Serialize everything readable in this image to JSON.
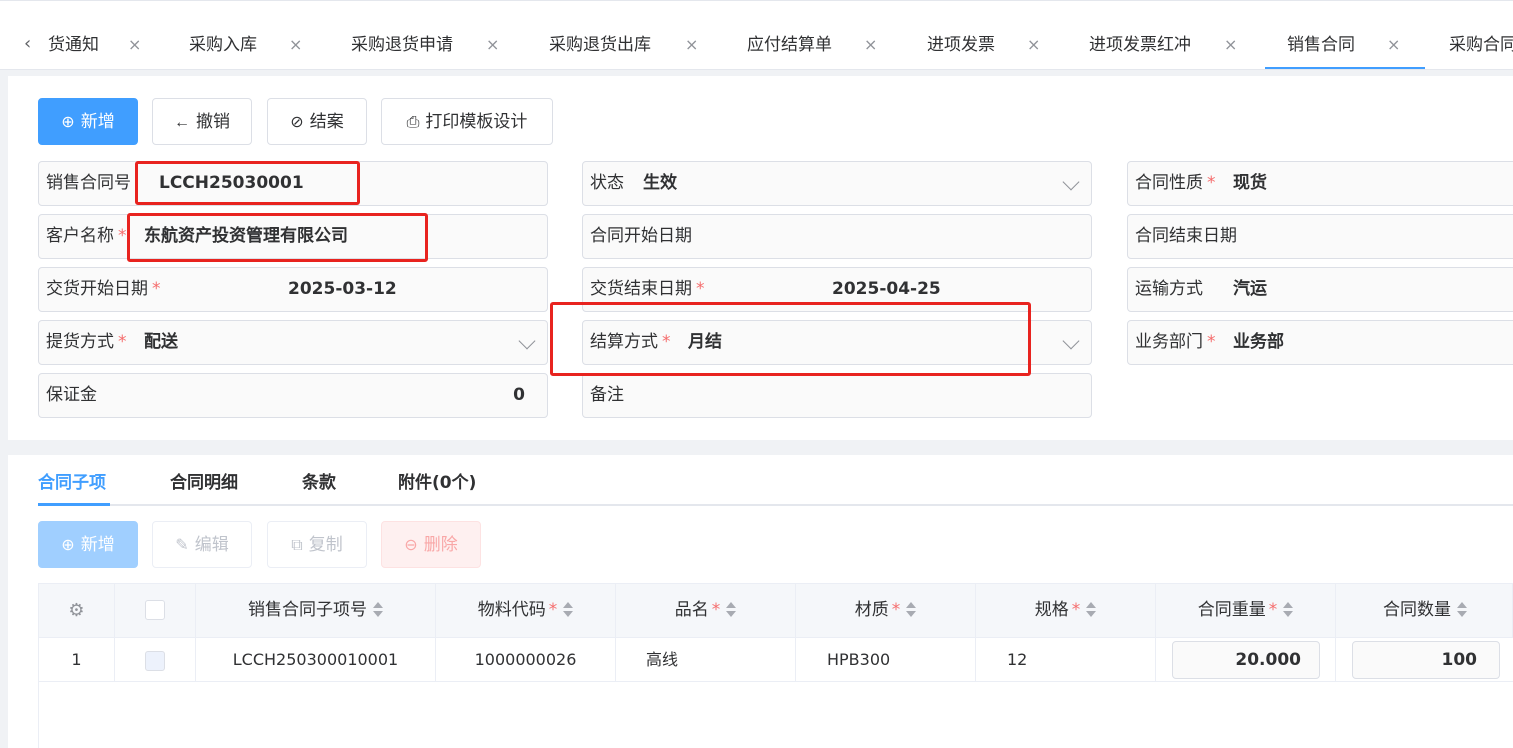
{
  "tabs": [
    {
      "label": "货通知"
    },
    {
      "label": "采购入库"
    },
    {
      "label": "采购退货申请"
    },
    {
      "label": "采购退货出库"
    },
    {
      "label": "应付结算单"
    },
    {
      "label": "进项发票"
    },
    {
      "label": "进项发票红冲"
    },
    {
      "label": "销售合同"
    },
    {
      "label": "采购合同"
    }
  ],
  "toolbar": {
    "add": "新增",
    "revoke": "撤销",
    "close_case": "结案",
    "print_design": "打印模板设计"
  },
  "form": {
    "contract_no": {
      "label": "销售合同号",
      "value": "LCCH25030001"
    },
    "status": {
      "label": "状态",
      "value": "生效"
    },
    "contract_nature": {
      "label": "合同性质",
      "value": "现货"
    },
    "customer": {
      "label": "客户名称",
      "value": "东航资产投资管理有限公司"
    },
    "start_date": {
      "label": "合同开始日期",
      "value": ""
    },
    "end_date": {
      "label": "合同结束日期",
      "value": ""
    },
    "delivery_start": {
      "label": "交货开始日期",
      "value": "2025-03-12"
    },
    "delivery_end": {
      "label": "交货结束日期",
      "value": "2025-04-25"
    },
    "transport": {
      "label": "运输方式",
      "value": "汽运"
    },
    "pickup": {
      "label": "提货方式",
      "value": "配送"
    },
    "settlement": {
      "label": "结算方式",
      "value": "月结"
    },
    "department": {
      "label": "业务部门",
      "value": "业务部"
    },
    "deposit": {
      "label": "保证金",
      "value": "0"
    },
    "remark": {
      "label": "备注",
      "value": ""
    }
  },
  "subtabs": [
    "合同子项",
    "合同明细",
    "条款",
    "附件(0个)"
  ],
  "subtoolbar": {
    "add": "新增",
    "edit": "编辑",
    "copy": "复制",
    "delete": "删除"
  },
  "table": {
    "headers": {
      "item_no": "销售合同子项号",
      "material_code": "物料代码",
      "name": "品名",
      "material": "材质",
      "spec": "规格",
      "weight": "合同重量",
      "qty": "合同数量"
    },
    "rows": [
      {
        "index": "1",
        "item_no": "LCCH250300010001",
        "material_code": "1000000026",
        "name": "高线",
        "material": "HPB300",
        "spec": "12",
        "weight": "20.000",
        "qty": "100"
      }
    ]
  },
  "colors": {
    "primary": "#409eff",
    "highlight_box": "#e8231f",
    "required": "#f56c6c"
  }
}
